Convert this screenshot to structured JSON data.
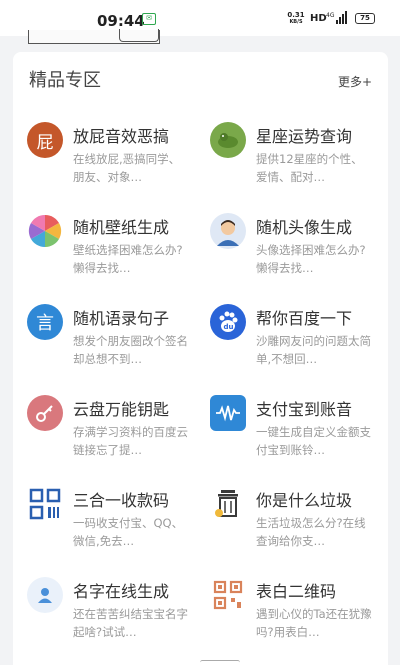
{
  "status_bar": {
    "time": "09:44",
    "message_badge": "✉",
    "net_speed_value": "0.31",
    "net_speed_unit": "KB/S",
    "network_label": "HD",
    "signal_label": "4G",
    "battery": "75"
  },
  "section": {
    "title": "精品专区",
    "more": "更多+"
  },
  "items": [
    {
      "title": "放屁音效恶搞",
      "desc": "在线放屁,恶搞同学、朋友、对象…",
      "icon": "fart-icon",
      "glyph": "屁",
      "color": "#c4572a"
    },
    {
      "title": "星座运势查询",
      "desc": "提供12星座的个性、爱情、配对…",
      "icon": "horoscope-icon",
      "glyph": "",
      "color": "#6a9a3a"
    },
    {
      "title": "随机壁纸生成",
      "desc": "壁纸选择困难怎么办?懒得去找…",
      "icon": "wallpaper-icon",
      "glyph": "",
      "color": "#e96a6a"
    },
    {
      "title": "随机头像生成",
      "desc": "头像选择困难怎么办?懒得去找…",
      "icon": "avatar-icon",
      "glyph": "",
      "color": "#3b6fb6"
    },
    {
      "title": "随机语录句子",
      "desc": "想发个朋友圈改个签名却总想不到…",
      "icon": "quote-icon",
      "glyph": "言",
      "color": "#2f88d6"
    },
    {
      "title": "帮你百度一下",
      "desc": "沙雕网友问的问题太简单,不想回…",
      "icon": "baidu-icon",
      "glyph": "du",
      "color": "#2a64d8"
    },
    {
      "title": "云盘万能钥匙",
      "desc": "存满学习资料的百度云链接忘了提…",
      "icon": "key-icon",
      "glyph": "",
      "color": "#d9787d"
    },
    {
      "title": "支付宝到账音",
      "desc": "一键生成自定义金额支付宝到账铃…",
      "icon": "alipay-sound-icon",
      "glyph": "",
      "color": "#2f88d6"
    },
    {
      "title": "三合一收款码",
      "desc": "一码收支付宝、QQ、微信,免去…",
      "icon": "payment-qr-icon",
      "glyph": "",
      "color": "#2a5fb0"
    },
    {
      "title": "你是什么垃圾",
      "desc": "生活垃圾怎么分?在线查询给你支…",
      "icon": "trash-icon",
      "glyph": "",
      "color": "#3a3a3a"
    },
    {
      "title": "名字在线生成",
      "desc": "还在苦苦纠结宝宝名字起啥?试试…",
      "icon": "name-icon",
      "glyph": "",
      "color": "#4a90d9"
    },
    {
      "title": "表白二维码",
      "desc": "遇到心仪的Ta还在犹豫吗?用表白…",
      "icon": "love-qr-icon",
      "glyph": "",
      "color": "#d9835a"
    }
  ]
}
